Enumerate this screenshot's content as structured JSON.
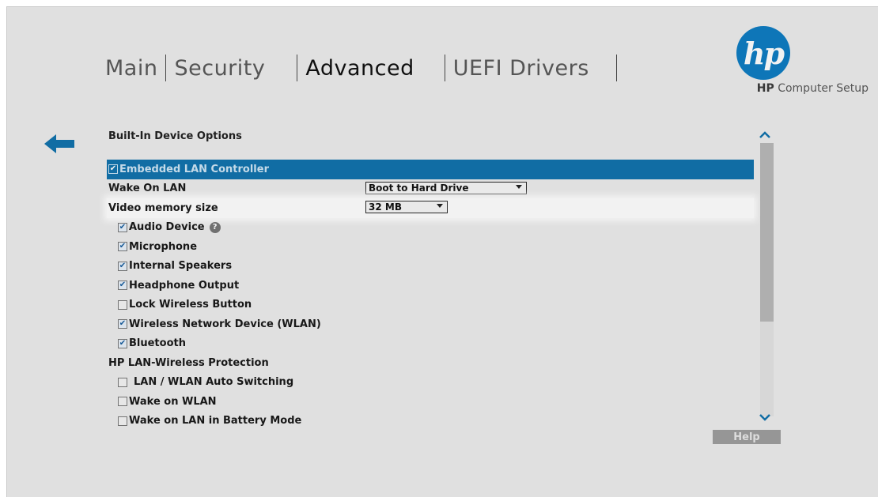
{
  "tabs": [
    {
      "label": "Main"
    },
    {
      "label": "Security"
    },
    {
      "label": "Advanced"
    },
    {
      "label": "UEFI Drivers"
    }
  ],
  "logo": {
    "text": "hp"
  },
  "setup_title": {
    "brand": "HP",
    "rest": " Computer Setup"
  },
  "section": {
    "title": "Built-In Device Options"
  },
  "rows": [
    {
      "label": "Embedded LAN Controller",
      "checked": true
    },
    {
      "label": "Wake On LAN",
      "select": "Boot to Hard Drive"
    },
    {
      "label": "Video memory size",
      "select": "32 MB"
    },
    {
      "label": "Audio Device",
      "checked": true
    },
    {
      "label": "Microphone",
      "checked": true
    },
    {
      "label": "Internal Speakers",
      "checked": true
    },
    {
      "label": "Headphone Output",
      "checked": true
    },
    {
      "label": "Lock Wireless Button",
      "checked": false
    },
    {
      "label": "Wireless Network Device (WLAN)",
      "checked": true
    },
    {
      "label": "Bluetooth",
      "checked": true
    },
    {
      "label": "HP LAN-Wireless Protection"
    },
    {
      "label": "LAN / WLAN Auto Switching",
      "checked": false
    },
    {
      "label": "Wake on WLAN",
      "checked": false
    },
    {
      "label": "Wake on LAN in Battery Mode",
      "checked": false
    }
  ],
  "help_button": {
    "label": "Help"
  },
  "colors": {
    "accent": "#1273ad",
    "logo": "#0f7dc2"
  }
}
